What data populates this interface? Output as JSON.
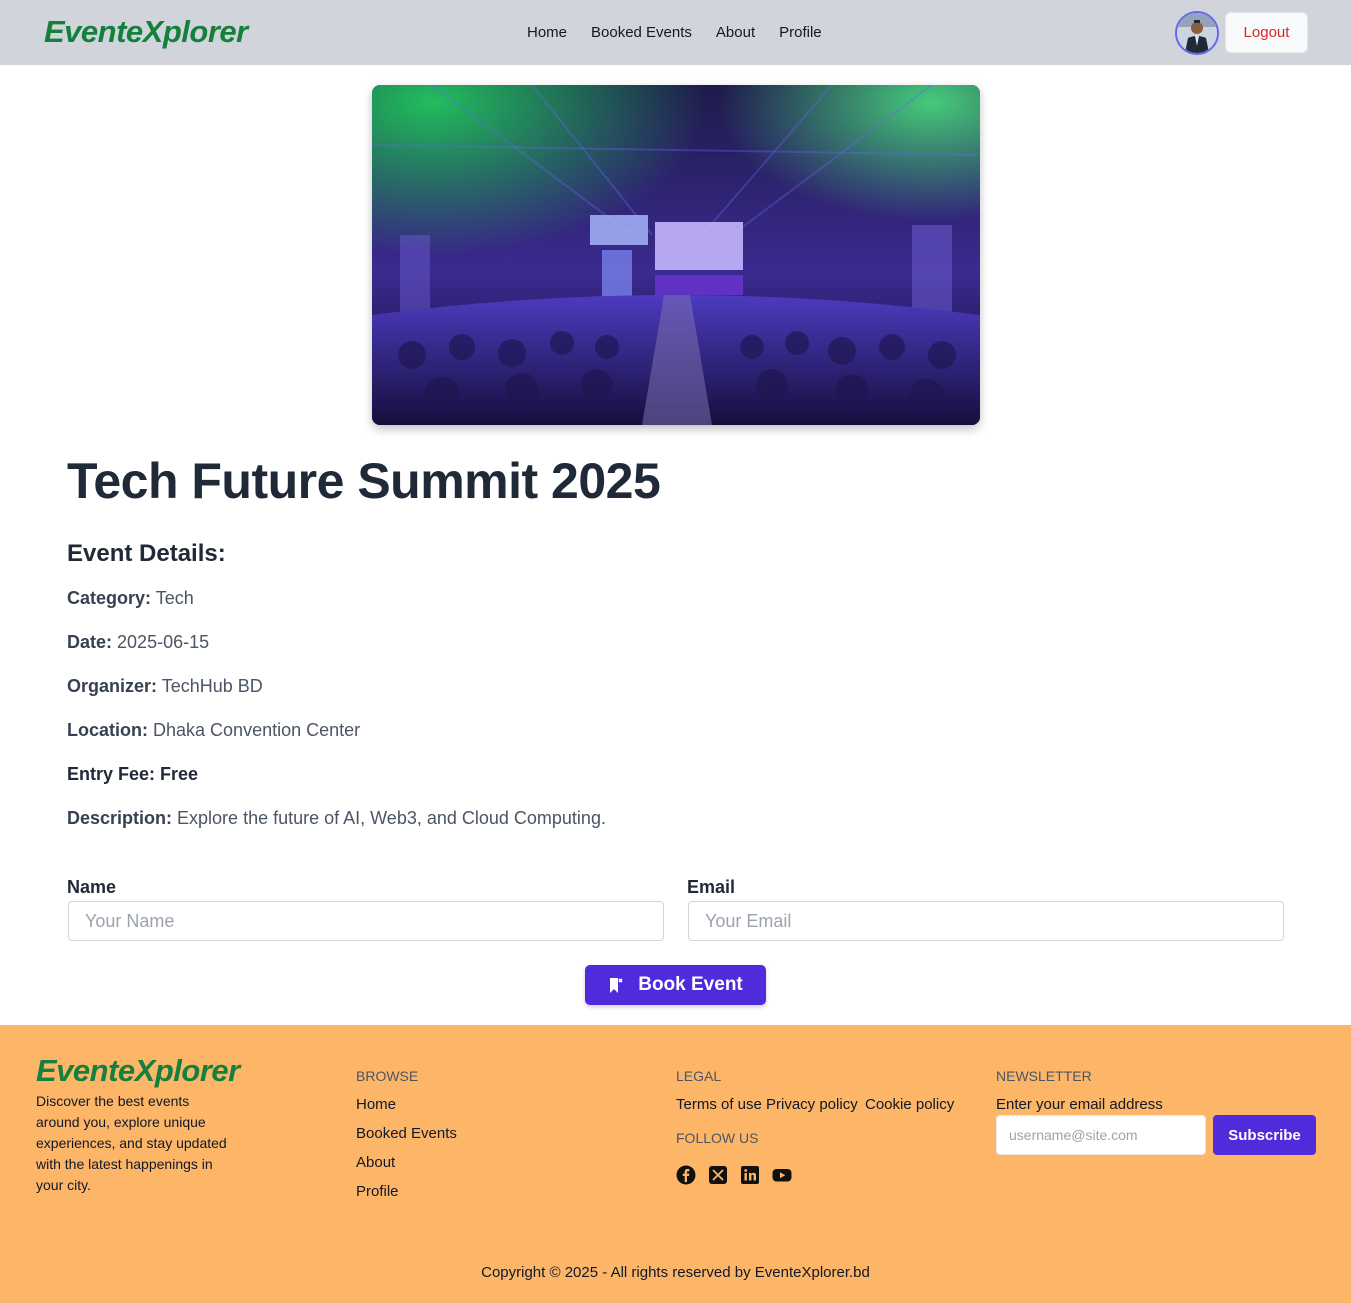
{
  "navbar": {
    "brand": "EventeXplorer",
    "links": [
      "Home",
      "Booked Events",
      "About",
      "Profile"
    ],
    "logout_label": "Logout"
  },
  "event": {
    "title": "Tech Future Summit 2025",
    "details_heading": "Event Details:",
    "category_label": "Category:",
    "category": "Tech",
    "date_label": "Date:",
    "date": "2025-06-15",
    "organizer_label": "Organizer:",
    "organizer": "TechHub BD",
    "location_label": "Location:",
    "location": "Dhaka Convention Center",
    "fee_label": "Entry Fee:",
    "fee": "Free",
    "description_label": "Description:",
    "description": "Explore the future of AI, Web3, and Cloud Computing."
  },
  "form": {
    "name_label": "Name",
    "name_placeholder": "Your Name",
    "email_label": "Email",
    "email_placeholder": "Your Email",
    "book_label": "Book Event"
  },
  "footer": {
    "brand": "EventeXplorer",
    "description": "Discover the best events around you, explore unique experiences, and stay updated with the latest happenings in your city.",
    "browse_title": "BROWSE",
    "browse_links": [
      "Home",
      "Booked Events",
      "About",
      "Profile"
    ],
    "legal_title": "LEGAL",
    "legal_links": [
      "Terms of use",
      "Privacy policy",
      "Cookie policy"
    ],
    "follow_title": "FOLLOW US",
    "social_icons": [
      "facebook-icon",
      "x-icon",
      "linkedin-icon",
      "youtube-icon"
    ],
    "newsletter_title": "NEWSLETTER",
    "newsletter_label": "Enter your email address",
    "newsletter_placeholder": "username@site.com",
    "subscribe_label": "Subscribe",
    "copyright": "Copyright © 2025 - All rights reserved by EventeXplorer.bd"
  },
  "colors": {
    "brand_green": "#15803d",
    "navbar_bg": "#d1d5db",
    "footer_bg": "#fdb668",
    "primary_button": "#4f2bdc",
    "logout_text": "#dc2626"
  }
}
